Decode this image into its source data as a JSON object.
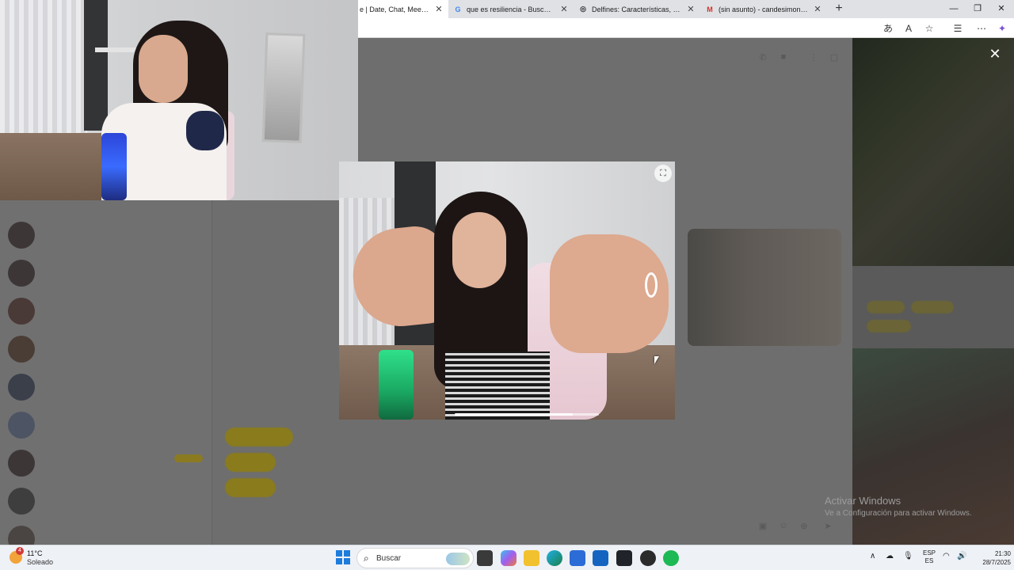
{
  "browser": {
    "tabs": [
      {
        "title": "e | Date, Chat, Meet New P",
        "icon": "dating-app-icon",
        "active": true
      },
      {
        "title": "que es resiliencia - Buscar con Go",
        "icon": "google-icon",
        "active": false
      },
      {
        "title": "Delfines: Características, Hábitat y",
        "icon": "site-favicon-icon",
        "active": false
      },
      {
        "title": "(sin asunto) - candesimoneit@gm",
        "icon": "gmail-icon",
        "active": false
      }
    ],
    "tab_close": "✕",
    "new_tab": "+",
    "window_controls": {
      "minimize": "—",
      "maximize": "❐",
      "close": "✕"
    }
  },
  "viewer": {
    "close_label": "✕",
    "expand_icon": "expand-icon",
    "progress": 0.82
  },
  "watermark": {
    "line1": "Activar Windows",
    "line2": "Ve a Configuración para activar Windows."
  },
  "taskbar": {
    "weather": {
      "badge": "4",
      "temp": "11°C",
      "condition": "Soleado"
    },
    "search_label": "Buscar",
    "language": {
      "top": "ESP",
      "bottom": "ES"
    },
    "clock": {
      "time": "21:30",
      "date": "28/7/2025"
    }
  },
  "colors": {
    "accent_yellow": "#8a7b1d",
    "taskbar_bg": "#eef1f6",
    "dim_overlay": "#6c6c6c"
  }
}
